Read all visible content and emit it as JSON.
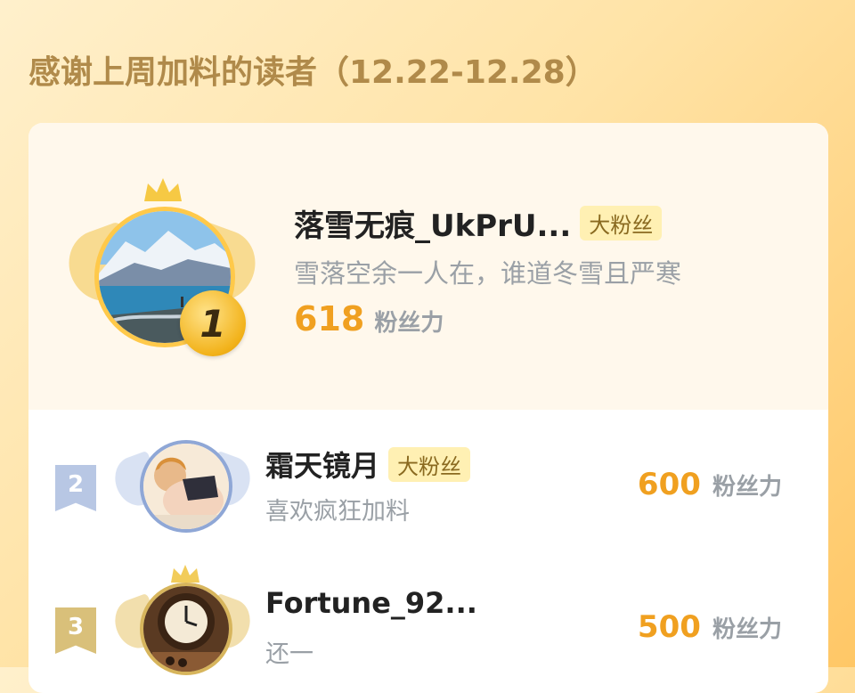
{
  "header": {
    "title": "感谢上周加料的读者（12.22-12.28）"
  },
  "colors": {
    "accent": "#f0a020",
    "badge_bg": "#fff0b3",
    "rank2": "#b8c7e4",
    "rank3": "#d9c07a"
  },
  "top_reader": {
    "rank": "1",
    "name": "落雪无痕_UkPrU...",
    "badge": "大粉丝",
    "description": "雪落空余一人在，谁道冬雪且严寒",
    "power_value": "618",
    "power_unit": "粉丝力",
    "avatar_icon": "snow-mountain-lake-photo"
  },
  "readers": [
    {
      "rank": "2",
      "name": "霜天镜月",
      "badge": "大粉丝",
      "description": "喜欢疯狂加料",
      "power_value": "600",
      "power_unit": "粉丝力",
      "avatar_icon": "anime-girl-avatar"
    },
    {
      "rank": "3",
      "name": "Fortune_92...",
      "badge": "",
      "description": "还一",
      "power_value": "500",
      "power_unit": "粉丝力",
      "avatar_icon": "antique-clock-avatar"
    }
  ]
}
